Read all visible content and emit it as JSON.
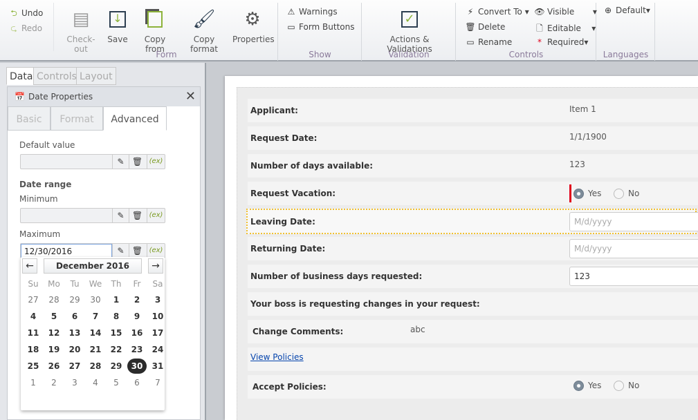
{
  "ribbon": {
    "undo": "Undo",
    "redo": "Redo",
    "form": {
      "label": "Form",
      "checkout": "Check-out",
      "save": "Save",
      "copy_from": "Copy from",
      "copy_format": "Copy format",
      "properties": "Properties"
    },
    "show": {
      "label": "Show",
      "warnings": "Warnings",
      "form_buttons": "Form Buttons"
    },
    "validation": {
      "label": "Validation",
      "actions": "Actions & Validations"
    },
    "controls": {
      "label": "Controls",
      "convert_to": "Convert To",
      "delete": "Delete",
      "rename": "Rename",
      "visible": "Visible",
      "editable": "Editable",
      "required": "Required"
    },
    "languages": {
      "label": "Languages",
      "default": "Default"
    }
  },
  "left": {
    "tabs": [
      "Data",
      "Controls",
      "Layout"
    ],
    "panel_title": "Date Properties",
    "subtabs": [
      "Basic",
      "Format",
      "Advanced"
    ],
    "default_value_label": "Default value",
    "default_value": "",
    "date_range_label": "Date range",
    "minimum_label": "Minimum",
    "minimum": "",
    "maximum_label": "Maximum",
    "maximum": "12/30/2016",
    "expr_label": "(ex)"
  },
  "calendar": {
    "month": "December 2016",
    "prev": "←",
    "next": "→",
    "weekdays": [
      "Su",
      "Mo",
      "Tu",
      "We",
      "Th",
      "Fr",
      "Sa"
    ],
    "weeks": [
      [
        "27",
        "28",
        "29",
        "30",
        "1",
        "2",
        "3"
      ],
      [
        "4",
        "5",
        "6",
        "7",
        "8",
        "9",
        "10"
      ],
      [
        "11",
        "12",
        "13",
        "14",
        "15",
        "16",
        "17"
      ],
      [
        "18",
        "19",
        "20",
        "21",
        "22",
        "23",
        "24"
      ],
      [
        "25",
        "26",
        "27",
        "28",
        "29",
        "30",
        "31"
      ],
      [
        "1",
        "2",
        "3",
        "4",
        "5",
        "6",
        "7"
      ]
    ],
    "selected": "30"
  },
  "form": {
    "applicant": {
      "label": "Applicant:",
      "value": "Item 1"
    },
    "request_date": {
      "label": "Request Date:",
      "value": "1/1/1900"
    },
    "days_available": {
      "label": "Number of days available:",
      "value": "123"
    },
    "request_vacation": {
      "label": "Request Vacation:",
      "yes": "Yes",
      "no": "No",
      "selected": "Yes"
    },
    "leaving_date": {
      "label": "Leaving Date:",
      "placeholder": "M/d/yyyy"
    },
    "returning_date": {
      "label": "Returning Date:",
      "placeholder": "M/d/yyyy"
    },
    "business_days": {
      "label": "Number of business days requested:",
      "value": "123"
    },
    "boss_message": "Your boss is requesting changes in your request:",
    "change_comments": {
      "label": "Change Comments:",
      "value": "abc"
    },
    "view_policies": "View Policies",
    "accept_policies": {
      "label": "Accept Policies:",
      "yes": "Yes",
      "no": "No",
      "selected": "Yes"
    }
  },
  "colors": {
    "accent": "#8db33a",
    "required_bar": "#e0001b",
    "focus_border": "#f0c030",
    "link": "#0645ad"
  }
}
